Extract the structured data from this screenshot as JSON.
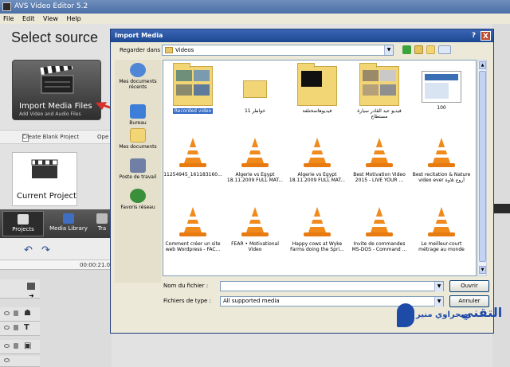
{
  "app": {
    "title": "AVS Video Editor 5.2",
    "menu": [
      "File",
      "Edit",
      "View",
      "Help"
    ]
  },
  "main": {
    "heading": "Select source",
    "import_title": "Import Media Files",
    "import_sub": "Add Video and Audio Files",
    "create_blank": "Create Blank Project",
    "open_partial": "Ope",
    "current_project": "Current Project",
    "tabs": [
      "Projects",
      "Media Library",
      "Tra"
    ],
    "timeline_time": "00:00:21.0"
  },
  "dialog": {
    "title": "Import Media",
    "help": "?",
    "close": "X",
    "lookin_label": "Regarder dans :",
    "lookin_value": "Videos",
    "places": [
      "Mes documents récents",
      "Bureau",
      "Mes documents",
      "Poste de travail",
      "Favoris réseau"
    ],
    "items": [
      {
        "name": "Recorded video",
        "kind": "folder"
      },
      {
        "name": "خواطر 11",
        "kind": "folder"
      },
      {
        "name": "فيديوهاتمختلفة",
        "kind": "folder"
      },
      {
        "name": "فيديو عبد القادر سيارة مستطاع",
        "kind": "folder"
      },
      {
        "name": "100",
        "kind": "image"
      },
      {
        "name": "11254945_161183160...",
        "kind": "vlc"
      },
      {
        "name": "Algerie vs Egypt 18.11.2009 FULL MAT...",
        "kind": "vlc"
      },
      {
        "name": "Algerie vs Egypt 18.11.2009 FULL MAT...",
        "kind": "vlc"
      },
      {
        "name": "Best Motivation Video 2015 - LIVE YOUR ...",
        "kind": "vlc"
      },
      {
        "name": "Best recitation & Nature video ever أروع تلاوة",
        "kind": "vlc"
      },
      {
        "name": "Comment créer un site web Wordpress - FAC...",
        "kind": "vlc"
      },
      {
        "name": "FEAR • Motivational Video",
        "kind": "vlc"
      },
      {
        "name": "Happy cows at Wyke Farms doing the Spri...",
        "kind": "vlc"
      },
      {
        "name": "Invite de commandes MS-DOS - Command ...",
        "kind": "vlc"
      },
      {
        "name": "Le meilleur-court métrage au monde",
        "kind": "vlc"
      }
    ],
    "filename_label": "Nom du fichier :",
    "filename_value": "",
    "filetype_label": "Fichiers de type :",
    "filetype_value": "All supported media",
    "open_btn": "Ouvrir",
    "cancel_btn": "Annuler"
  },
  "watermark": {
    "small": "صحراوي منير",
    "big": "التقني"
  },
  "colors": {
    "title_blue": "#1b4792",
    "folder_yellow": "#f2d676",
    "vlc_orange": "#f08a1c",
    "arrow_red": "#d8312b"
  }
}
